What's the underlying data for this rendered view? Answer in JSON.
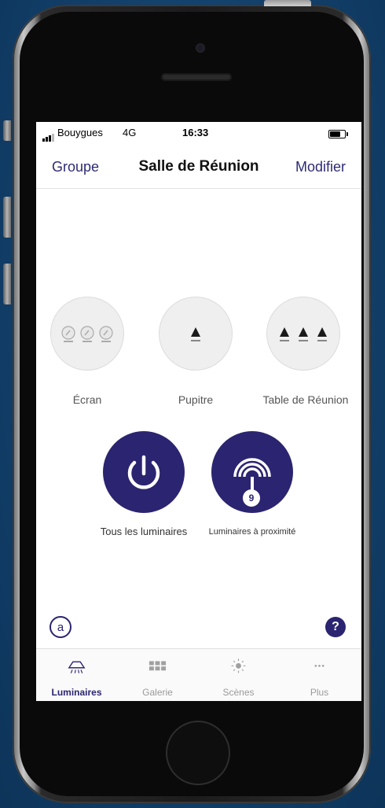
{
  "status_bar": {
    "carrier": "Bouygues",
    "network": "4G",
    "time": "16:33",
    "battery_level": 0.7
  },
  "nav": {
    "left_label": "Groupe",
    "title": "Salle de Réunion",
    "right_label": "Modifier"
  },
  "groups": [
    {
      "label": "Écran",
      "luminaire_count": 3,
      "state": "off"
    },
    {
      "label": "Pupitre",
      "luminaire_count": 1,
      "state": "on"
    },
    {
      "label": "Table de Réunion",
      "luminaire_count": 3,
      "state": "on"
    }
  ],
  "actions": {
    "all_label": "Tous les luminaires",
    "proximity_label": "Luminaires à proximité",
    "proximity_count": "9"
  },
  "help": {
    "left_symbol": "@",
    "right_symbol": "?"
  },
  "tabs": [
    {
      "label": "Luminaires",
      "icon": "luminaire-icon",
      "active": true
    },
    {
      "label": "Galerie",
      "icon": "grid-icon",
      "active": false
    },
    {
      "label": "Scènes",
      "icon": "sun-icon",
      "active": false
    },
    {
      "label": "Plus",
      "icon": "more-icon",
      "active": false
    }
  ],
  "colors": {
    "accent": "#2b2470",
    "screen_bg": "#ffffff",
    "circle_bg": "#efefef"
  }
}
